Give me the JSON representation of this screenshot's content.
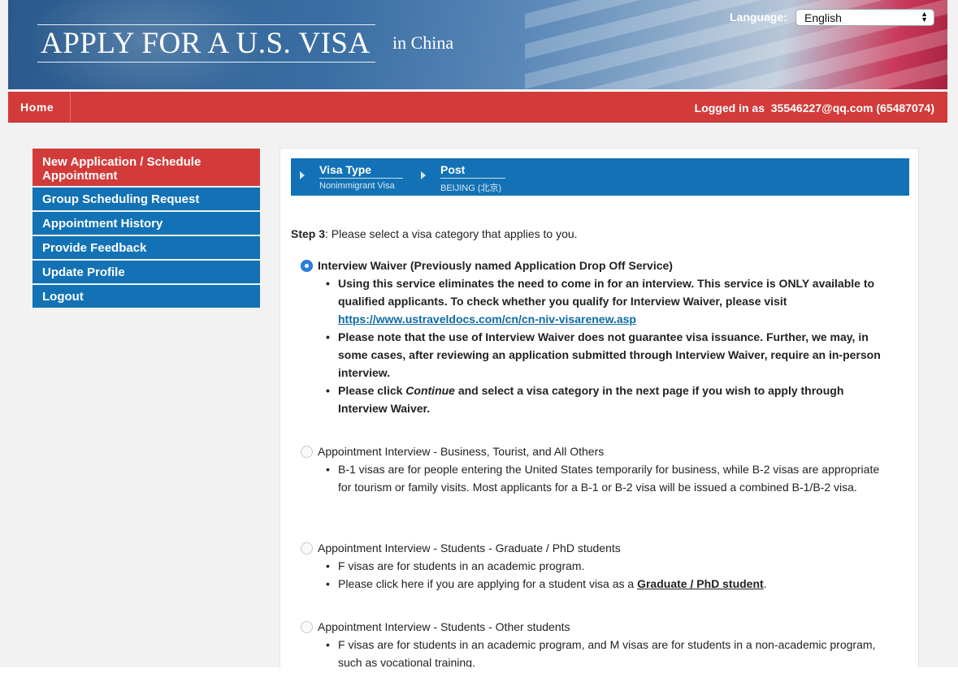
{
  "banner": {
    "title": "APPLY FOR A U.S. VISA",
    "country": "in  China",
    "language_label": "Language:",
    "language_value": "English"
  },
  "nav": {
    "home": "Home",
    "logged_in_prefix": "Logged in as",
    "user": "35546227@qq.com (65487074)"
  },
  "sidebar": {
    "items": [
      {
        "label": "New Application / Schedule Appointment"
      },
      {
        "label": "Group Scheduling Request"
      },
      {
        "label": "Appointment History"
      },
      {
        "label": "Provide Feedback"
      },
      {
        "label": "Update Profile"
      },
      {
        "label": "Logout"
      }
    ]
  },
  "breadcrumb": {
    "steps": [
      {
        "label": "Visa Type",
        "value": "Nonimmigrant Visa"
      },
      {
        "label": "Post",
        "value": "BEIJING (北京)"
      }
    ]
  },
  "step": {
    "label": "Step 3",
    "text": ": Please select a visa category that applies to you."
  },
  "options": [
    {
      "title": "Interview Waiver (Previously named Application Drop Off Service)",
      "selected": true,
      "bullet1_text": "Using this service eliminates the need to come in for an interview. This service is ONLY available to qualified applicants. To check whether you qualify for Interview Waiver, please visit ",
      "bullet1_link": "https://www.ustraveldocs.com/cn/cn-niv-visarenew.asp",
      "bullet2": "Please note that the use of Interview Waiver does not guarantee visa issuance. Further, we may, in some cases, after reviewing an application submitted through Interview Waiver, require an in-person interview.",
      "bullet3_pre": "Please click ",
      "bullet3_em": "Continue",
      "bullet3_post": " and select a visa category in the next page if you wish to apply through Interview Waiver."
    },
    {
      "title": "Appointment Interview - Business, Tourist, and All Others",
      "selected": false,
      "bullet1": "B-1 visas are for people entering the United States temporarily for business, while B-2 visas are appropriate for tourism or family visits. Most applicants for a B-1 or B-2 visa will be issued a combined B-1/B-2 visa."
    },
    {
      "title": "Appointment Interview - Students - Graduate / PhD students",
      "selected": false,
      "bullet1": "F visas are for students in an academic program.",
      "bullet2_pre": "Please click here if you are applying for a student visa as a ",
      "bullet2_link": "Graduate / PhD student",
      "bullet2_post": "."
    },
    {
      "title": "Appointment Interview - Students - Other students",
      "selected": false,
      "bullet1": "F visas are for students in an academic program, and M visas are for students in a non-academic program, such as vocational training."
    }
  ]
}
